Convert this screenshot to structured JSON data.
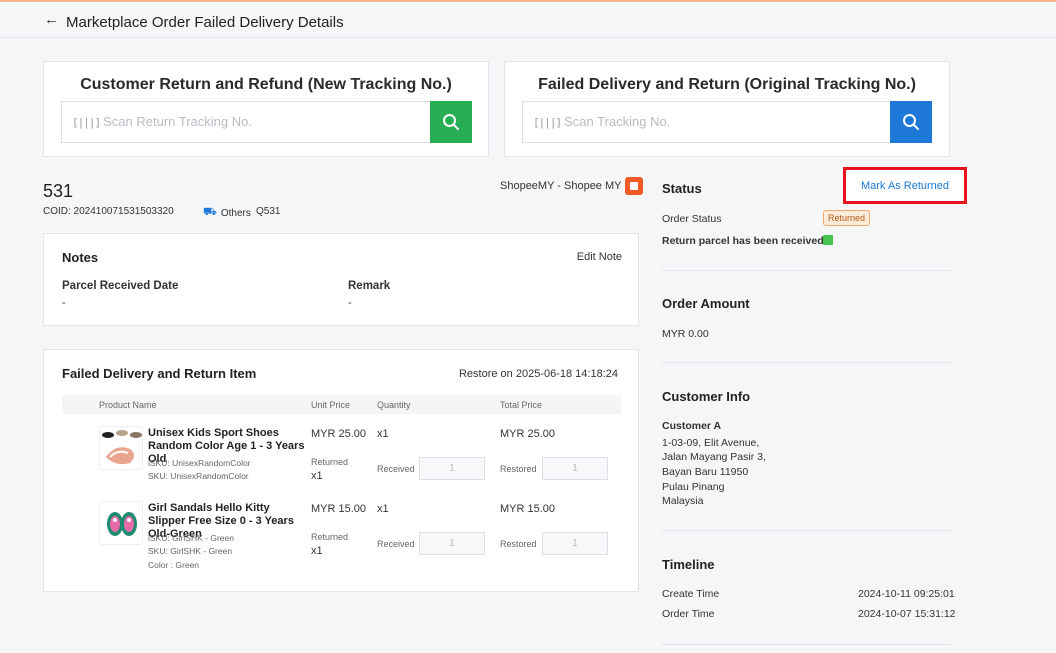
{
  "header": {
    "title": "Marketplace Order Failed Delivery Details"
  },
  "scan_return": {
    "title": "Customer Return and Refund (New Tracking No.)",
    "placeholder": "Scan Return Tracking No.",
    "barcode_glyph": "[|||]",
    "button_color": "#27ae54"
  },
  "scan_original": {
    "title": "Failed Delivery and Return (Original Tracking No.)",
    "placeholder": "Scan Tracking No.",
    "barcode_glyph": "[|||]",
    "button_color": "#1e78d7"
  },
  "order": {
    "number": "531",
    "coid": "COID: 202410071531503320",
    "shipping": "Others",
    "q_number": "Q531",
    "shop": "ShopeeMY - Shopee MY"
  },
  "notes": {
    "title": "Notes",
    "edit_label": "Edit Note",
    "parcel_received_label": "Parcel Received Date",
    "parcel_received_value": "-",
    "remark_label": "Remark",
    "remark_value": "-"
  },
  "items": {
    "title": "Failed Delivery and Return Item",
    "restore_text": "Restore on 2025-06-18 14:18:24",
    "columns": [
      "Product Name",
      "Unit Price",
      "Quantity",
      "Total Price"
    ],
    "rows": [
      {
        "name": "Unisex Kids Sport Shoes Random Color Age 1 - 3 Years Old",
        "isku": "iSKU: UnisexRandomColor",
        "sku": "SKU: UnisexRandomColor",
        "color": "",
        "unit_price": "MYR 25.00",
        "quantity": "x1",
        "total_price": "MYR 25.00",
        "returned_label": "Returned",
        "returned_qty": "x1",
        "received_label": "Received",
        "received_value": "1",
        "restored_label": "Restored",
        "restored_value": "1"
      },
      {
        "name": "Girl Sandals Hello Kitty Slipper Free Size 0 - 3 Years Old-Green",
        "isku": "iSKU: GirlSHK - Green",
        "sku": "SKU: GirlSHK - Green",
        "color": "Color : Green",
        "unit_price": "MYR 15.00",
        "quantity": "x1",
        "total_price": "MYR 15.00",
        "returned_label": "Returned",
        "returned_qty": "x1",
        "received_label": "Received",
        "received_value": "1",
        "restored_label": "Restored",
        "restored_value": "1"
      }
    ]
  },
  "status": {
    "title": "Status",
    "mark_returned_label": "Mark As Returned",
    "order_status_label": "Order Status",
    "order_status_value": "Returned",
    "parcel_received_label": "Return parcel has been received"
  },
  "amount": {
    "title": "Order Amount",
    "value": "MYR 0.00"
  },
  "customer": {
    "title": "Customer Info",
    "name": "Customer A",
    "address_lines": [
      "1-03-09, Elit Avenue,",
      "Jalan Mayang Pasir 3,",
      "Bayan Baru 11950",
      "Pulau Pinang",
      "Malaysia"
    ]
  },
  "timeline": {
    "title": "Timeline",
    "create_label": "Create Time",
    "create_value": "2024-10-11 09:25:01",
    "order_label": "Order Time",
    "order_value": "2024-10-07 15:31:12"
  },
  "colors": {
    "accent_blue": "#1e78d7",
    "success_green": "#27ae54",
    "highlight_red": "#e8121c",
    "status_badge": "#fdebd9"
  }
}
